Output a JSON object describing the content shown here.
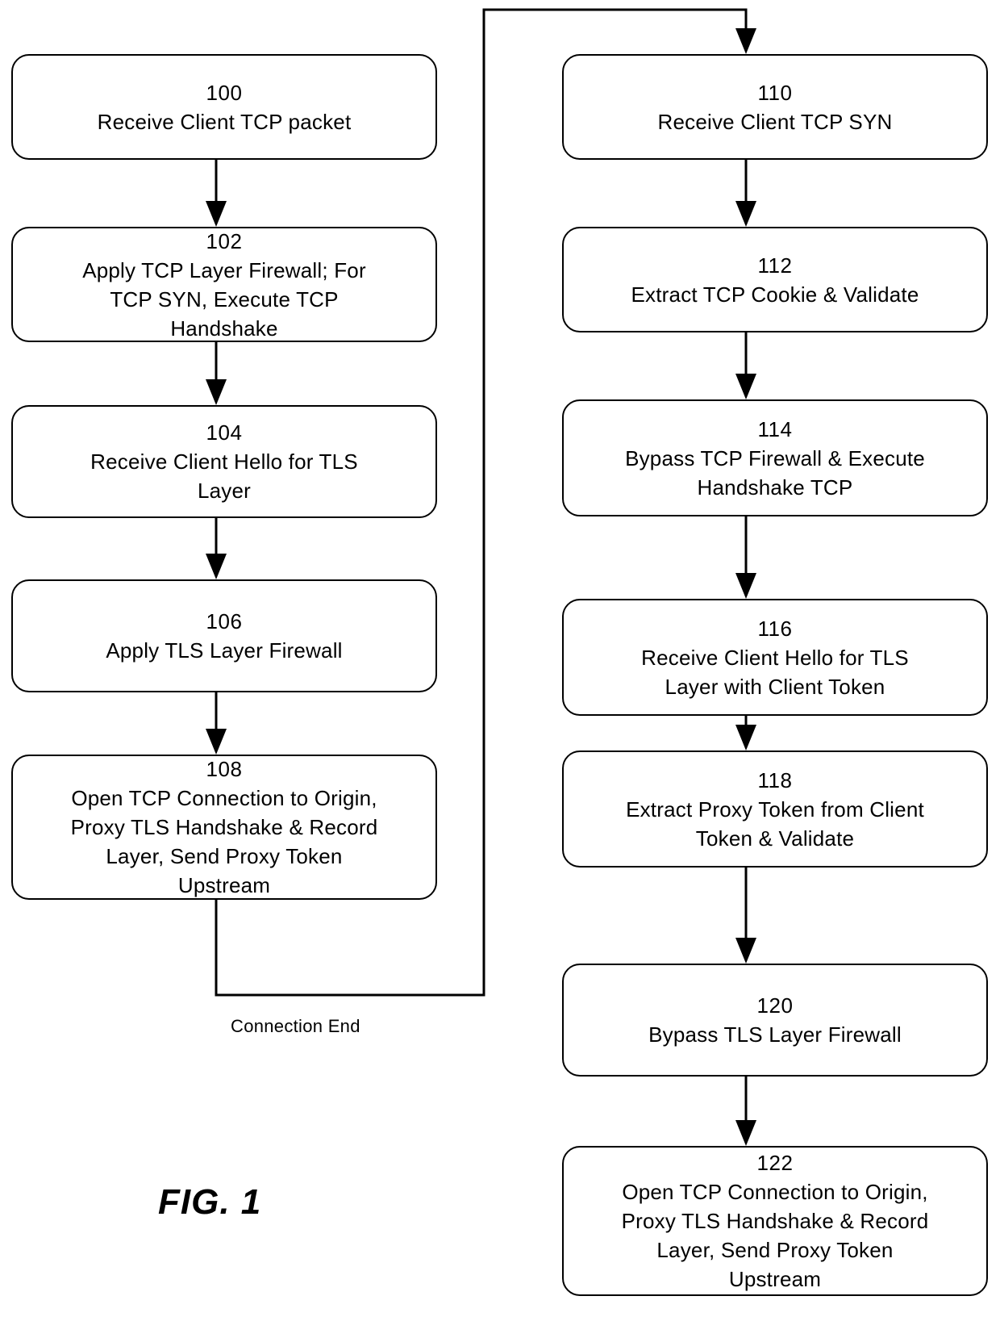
{
  "figure": {
    "label": "FIG. 1",
    "loop_label": "Connection End"
  },
  "left_column": {
    "boxes": [
      {
        "id": "100",
        "text": "Receive Client TCP packet"
      },
      {
        "id": "102",
        "text": "Apply TCP Layer Firewall; For\nTCP SYN, Execute TCP\nHandshake"
      },
      {
        "id": "104",
        "text": "Receive Client Hello for TLS\nLayer"
      },
      {
        "id": "106",
        "text": "Apply TLS Layer Firewall"
      },
      {
        "id": "108",
        "text": "Open TCP Connection to Origin,\nProxy TLS Handshake & Record\nLayer, Send Proxy Token\nUpstream"
      }
    ]
  },
  "right_column": {
    "boxes": [
      {
        "id": "110",
        "text": "Receive Client TCP SYN"
      },
      {
        "id": "112",
        "text": "Extract TCP Cookie & Validate"
      },
      {
        "id": "114",
        "text": "Bypass TCP Firewall & Execute\nHandshake TCP"
      },
      {
        "id": "116",
        "text": "Receive Client Hello for TLS\nLayer with Client Token"
      },
      {
        "id": "118",
        "text": "Extract Proxy Token from Client\nToken & Validate"
      },
      {
        "id": "120",
        "text": "Bypass TLS Layer Firewall"
      },
      {
        "id": "122",
        "text": "Open TCP Connection to Origin,\nProxy TLS Handshake & Record\nLayer, Send Proxy Token\nUpstream"
      }
    ]
  }
}
